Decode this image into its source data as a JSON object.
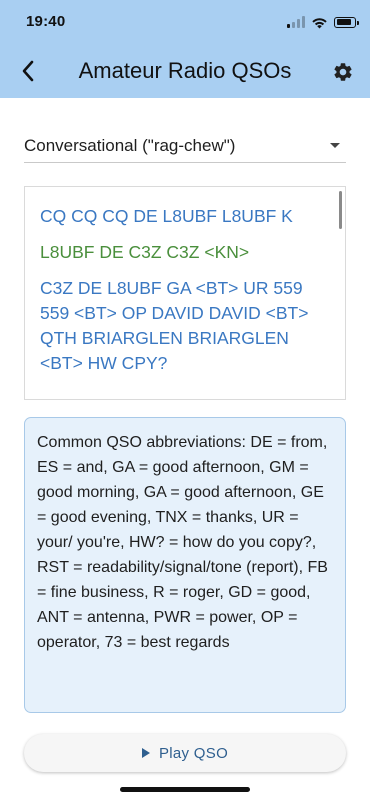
{
  "status_bar": {
    "time": "19:40",
    "signal_bars_active": 1,
    "signal_bars_total": 4,
    "icons": [
      "signal-icon",
      "wifi-icon",
      "battery-icon"
    ],
    "battery_level": 0.7
  },
  "app_bar": {
    "title": "Amateur Radio QSOs",
    "back_icon": "chevron-left-icon",
    "settings_icon": "gear-icon",
    "background_color": "#a9cff2"
  },
  "qso_type": {
    "selected": "Conversational (\"rag-chew\")",
    "caret_icon": "caret-down-icon"
  },
  "transcript": {
    "lines": [
      {
        "speaker": "me",
        "text": "CQ CQ CQ DE L8UBF L8UBF K"
      },
      {
        "speaker": "them",
        "text": "L8UBF DE C3Z C3Z <KN>"
      },
      {
        "speaker": "me",
        "text": "C3Z DE L8UBF GA <BT> UR 559 559 <BT> OP DAVID DAVID <BT> QTH BRIARGLEN BRIARGLEN <BT> HW CPY?"
      }
    ],
    "colors": {
      "me": "#3a78c2",
      "them": "#4a8f3c"
    }
  },
  "abbreviations": {
    "text": "Common QSO abbreviations: DE = from, ES = and, GA = good afternoon, GM = good morning, GA = good afternoon, GE = good evening, TNX = thanks, UR = your/ you're, HW? = how do you copy?, RST = readability/signal/tone (report), FB = fine business, R = roger, GD = good, ANT = antenna, PWR = power, OP = operator, 73 = best regards",
    "background_color": "#e6f1fb"
  },
  "play_button": {
    "label": "Play QSO",
    "icon": "play-icon"
  }
}
